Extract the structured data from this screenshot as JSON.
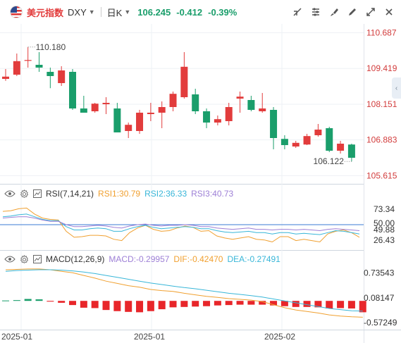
{
  "header": {
    "name": "美元指数",
    "symbol": "DXY",
    "period": "日K",
    "price": "106.245",
    "change": "-0.412",
    "change_pct": "-0.39%",
    "colors": {
      "up": "#e23c3c",
      "down": "#1a9e6b",
      "name": "#e23c3c"
    }
  },
  "toolbar": {
    "icons": [
      "draw-line-icon",
      "indicator-settings-icon",
      "brush-icon",
      "pencil-icon",
      "expand-icon",
      "close-icon"
    ]
  },
  "rsi": {
    "label": "RSI(7,14,21)",
    "rsi1": "RSI1:30.79",
    "rsi2": "RSI2:36.33",
    "rsi3": "RSI3:40.73",
    "colors": {
      "rsi1": "#f0a030",
      "rsi2": "#38b6d8",
      "rsi3": "#9d7fd6"
    }
  },
  "macd": {
    "label": "MACD(12,26,9)",
    "macd": "MACD:-0.29957",
    "dif": "DIF:-0.42470",
    "dea": "DEA:-0.27491",
    "colors": {
      "macd": "#9d7fd6",
      "dif": "#f0a030",
      "dea": "#38b6d8"
    }
  },
  "chart_data": [
    {
      "type": "candlestick",
      "panel": "price",
      "title": "",
      "y_ticks": [
        "110.687",
        "109.419",
        "108.151",
        "106.883",
        "105.615"
      ],
      "ylim": [
        105.5,
        110.8
      ],
      "annotations": {
        "high_label": "110.180",
        "low_label": "106.122"
      },
      "x_ticks": [
        "2025-01",
        "2025-01",
        "2025-02"
      ],
      "candles": [
        {
          "o": 109.05,
          "h": 109.4,
          "l": 108.98,
          "c": 109.13
        },
        {
          "o": 109.2,
          "h": 109.95,
          "l": 109.15,
          "c": 109.68
        },
        {
          "o": 109.7,
          "h": 110.18,
          "l": 109.45,
          "c": 109.72
        },
        {
          "o": 109.55,
          "h": 110.0,
          "l": 109.3,
          "c": 109.45
        },
        {
          "o": 109.3,
          "h": 109.45,
          "l": 108.72,
          "c": 109.15
        },
        {
          "o": 108.9,
          "h": 109.5,
          "l": 108.8,
          "c": 109.35
        },
        {
          "o": 109.3,
          "h": 109.4,
          "l": 107.95,
          "c": 108.0
        },
        {
          "o": 108.0,
          "h": 108.45,
          "l": 107.9,
          "c": 107.85
        },
        {
          "o": 107.9,
          "h": 108.2,
          "l": 107.85,
          "c": 108.17
        },
        {
          "o": 108.15,
          "h": 108.4,
          "l": 107.8,
          "c": 108.2
        },
        {
          "o": 108.0,
          "h": 108.2,
          "l": 107.2,
          "c": 107.15
        },
        {
          "o": 107.2,
          "h": 107.5,
          "l": 106.95,
          "c": 107.42
        },
        {
          "o": 107.2,
          "h": 107.95,
          "l": 107.1,
          "c": 107.85
        },
        {
          "o": 107.8,
          "h": 108.2,
          "l": 107.55,
          "c": 107.85
        },
        {
          "o": 107.85,
          "h": 108.25,
          "l": 107.3,
          "c": 108.05
        },
        {
          "o": 108.05,
          "h": 108.6,
          "l": 107.9,
          "c": 108.52
        },
        {
          "o": 108.4,
          "h": 110.0,
          "l": 108.35,
          "c": 109.48
        },
        {
          "o": 108.5,
          "h": 108.7,
          "l": 107.8,
          "c": 107.9
        },
        {
          "o": 107.9,
          "h": 108.0,
          "l": 107.3,
          "c": 107.5
        },
        {
          "o": 107.5,
          "h": 107.75,
          "l": 107.4,
          "c": 107.62
        },
        {
          "o": 107.55,
          "h": 108.2,
          "l": 107.4,
          "c": 108.05
        },
        {
          "o": 108.35,
          "h": 108.6,
          "l": 107.85,
          "c": 108.42
        },
        {
          "o": 108.3,
          "h": 108.45,
          "l": 107.9,
          "c": 107.95
        },
        {
          "o": 107.9,
          "h": 108.55,
          "l": 107.85,
          "c": 108.0
        },
        {
          "o": 107.95,
          "h": 108.05,
          "l": 106.55,
          "c": 106.95
        },
        {
          "o": 106.92,
          "h": 107.05,
          "l": 106.55,
          "c": 106.7
        },
        {
          "o": 106.65,
          "h": 106.85,
          "l": 106.6,
          "c": 106.78
        },
        {
          "o": 106.72,
          "h": 107.1,
          "l": 106.7,
          "c": 107.02
        },
        {
          "o": 107.05,
          "h": 107.45,
          "l": 107.0,
          "c": 107.25
        },
        {
          "o": 107.3,
          "h": 107.35,
          "l": 106.45,
          "c": 106.5
        },
        {
          "o": 106.5,
          "h": 106.85,
          "l": 106.4,
          "c": 106.75
        },
        {
          "o": 106.72,
          "h": 106.75,
          "l": 106.12,
          "c": 106.25
        }
      ]
    },
    {
      "type": "line",
      "panel": "rsi",
      "y_ticks": [
        "73.34",
        "50.00",
        "49.88",
        "26.43"
      ],
      "ylim": [
        15,
        85
      ],
      "reference_line": 50,
      "series": [
        {
          "name": "RSI1",
          "values": [
            70,
            71,
            74,
            75,
            66,
            60,
            58,
            57,
            40,
            31,
            32,
            34,
            34,
            33,
            28,
            26,
            38,
            45,
            49,
            43,
            40,
            41,
            45,
            48,
            46,
            40,
            41,
            33,
            30,
            28,
            30,
            32,
            28,
            27,
            24,
            32,
            32,
            26,
            28,
            26,
            24,
            36,
            40,
            42,
            38,
            31
          ]
        },
        {
          "name": "RSI2",
          "values": [
            62,
            63,
            65,
            66,
            62,
            58,
            56,
            56,
            47,
            42,
            42,
            44,
            45,
            44,
            40,
            40,
            44,
            47,
            49,
            46,
            44,
            45,
            46,
            47,
            46,
            44,
            44,
            41,
            39,
            38,
            39,
            40,
            38,
            38,
            36,
            38,
            38,
            36,
            37,
            36,
            35,
            38,
            41,
            40,
            38,
            36
          ]
        },
        {
          "name": "RSI3",
          "values": [
            60,
            61,
            62,
            62,
            60,
            57,
            55,
            55,
            50,
            47,
            47,
            48,
            49,
            48,
            46,
            45,
            48,
            50,
            51,
            49,
            48,
            49,
            49,
            50,
            49,
            47,
            47,
            45,
            44,
            43,
            44,
            45,
            43,
            43,
            42,
            43,
            43,
            42,
            43,
            42,
            41,
            43,
            44,
            43,
            42,
            41
          ]
        }
      ]
    },
    {
      "type": "bar+line",
      "panel": "macd",
      "y_ticks": [
        "0.73543",
        "0.08147",
        "-0.57249"
      ],
      "ylim": [
        -0.72,
        0.95
      ],
      "macd_values": [
        0.01,
        0.02,
        0.05,
        0.04,
        -0.02,
        -0.05,
        -0.11,
        -0.18,
        -0.19,
        -0.24,
        -0.27,
        -0.29,
        -0.3,
        -0.27,
        -0.22,
        -0.17,
        -0.16,
        -0.15,
        -0.14,
        -0.12,
        -0.11,
        -0.1,
        -0.1,
        -0.1,
        -0.12,
        -0.14,
        -0.16,
        -0.16,
        -0.17,
        -0.2,
        -0.19,
        -0.2,
        -0.3
      ],
      "series": [
        {
          "name": "DIF",
          "values": [
            0.82,
            0.83,
            0.84,
            0.84,
            0.82,
            0.78,
            0.74,
            0.67,
            0.6,
            0.52,
            0.46,
            0.4,
            0.36,
            0.3,
            0.27,
            0.25,
            0.2,
            0.16,
            0.12,
            0.09,
            0.06,
            0.04,
            0.02,
            -0.02,
            -0.1,
            -0.18,
            -0.24,
            -0.28,
            -0.32,
            -0.37,
            -0.4,
            -0.42,
            -0.43
          ]
        },
        {
          "name": "DEA",
          "values": [
            0.78,
            0.8,
            0.81,
            0.82,
            0.82,
            0.81,
            0.79,
            0.76,
            0.72,
            0.67,
            0.62,
            0.57,
            0.52,
            0.47,
            0.43,
            0.39,
            0.35,
            0.32,
            0.28,
            0.24,
            0.2,
            0.17,
            0.14,
            0.1,
            0.05,
            0.0,
            -0.05,
            -0.1,
            -0.15,
            -0.2,
            -0.23,
            -0.26,
            -0.27
          ]
        }
      ]
    }
  ]
}
